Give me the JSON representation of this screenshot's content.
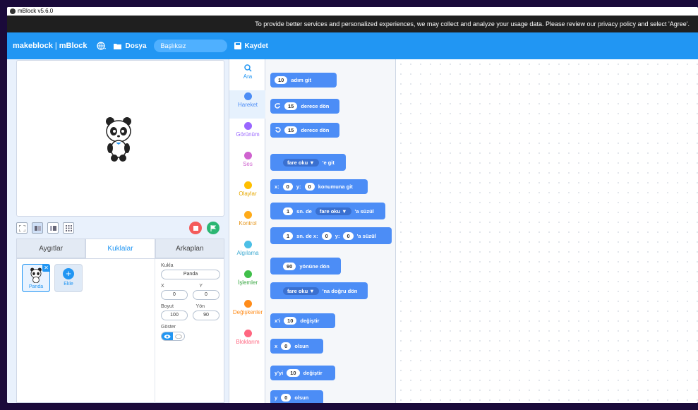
{
  "window": {
    "title": "mBlock v5.6.0"
  },
  "privacy_banner": "To provide better services and personalized experiences, we may collect and analyze your usage data. Please review our privacy policy and select 'Agree'.",
  "menubar": {
    "brand": "makeblock",
    "brand_sep": "|",
    "brand_product": "mBlock",
    "file_label": "Dosya",
    "project_name": "Başlıksız",
    "save_label": "Kaydet"
  },
  "tabs": [
    "Aygıtlar",
    "Kuklalar",
    "Arkaplan"
  ],
  "sprites": {
    "panda_label": "Panda",
    "add_label": "Ekle"
  },
  "props": {
    "sprite_label": "Kukla",
    "sprite_name": "Panda",
    "x_label": "X",
    "y_label": "Y",
    "x_value": "0",
    "y_value": "0",
    "size_label": "Boyut",
    "direction_label": "Yön",
    "size_value": "100",
    "direction_value": "90",
    "show_label": "Göster"
  },
  "categories": [
    {
      "label": "Ara",
      "color": "#2196f3"
    },
    {
      "label": "Hareket",
      "color": "#4c8df6"
    },
    {
      "label": "Görünüm",
      "color": "#9966ff"
    },
    {
      "label": "Ses",
      "color": "#cf63cf"
    },
    {
      "label": "Olaylar",
      "color": "#ffbf00"
    },
    {
      "label": "Kontrol",
      "color": "#ffab19"
    },
    {
      "label": "Algılama",
      "color": "#4cbfe6"
    },
    {
      "label": "İşlemler",
      "color": "#40bf4a"
    },
    {
      "label": "Değişkenler",
      "color": "#ff8c1a"
    },
    {
      "label": "Bloklarım",
      "color": "#ff6680"
    }
  ],
  "blocks": {
    "move": {
      "v": "10",
      "t": "adım git"
    },
    "turn_right": {
      "v": "15",
      "t": "derece dön"
    },
    "turn_left": {
      "v": "15",
      "t": "derece dön"
    },
    "goto": {
      "dd": "fare oku ▼",
      "t": "'e git"
    },
    "goto_xy": {
      "x": "x:",
      "xv": "0",
      "y": "y:",
      "yv": "0",
      "t": "konumuna git"
    },
    "glide": {
      "v": "1",
      "t1": "sn. de",
      "dd": "fare oku ▼",
      "t2": "'a süzül"
    },
    "glide_xy": {
      "v": "1",
      "t1": "sn. de x:",
      "xv": "0",
      "y": "y:",
      "yv": "0",
      "t2": "'a süzül"
    },
    "point_dir": {
      "v": "90",
      "t": "yönüne dön"
    },
    "point_towards": {
      "dd": "fare oku ▼",
      "t": "'na doğru dön"
    },
    "change_x": {
      "l": "x'i",
      "v": "10",
      "t": "değiştir"
    },
    "set_x": {
      "l": "x",
      "v": "0",
      "t": "olsun"
    },
    "change_y": {
      "l": "y'yi",
      "v": "10",
      "t": "değiştir"
    },
    "set_y": {
      "l": "y",
      "v": "0",
      "t": "olsun"
    }
  }
}
